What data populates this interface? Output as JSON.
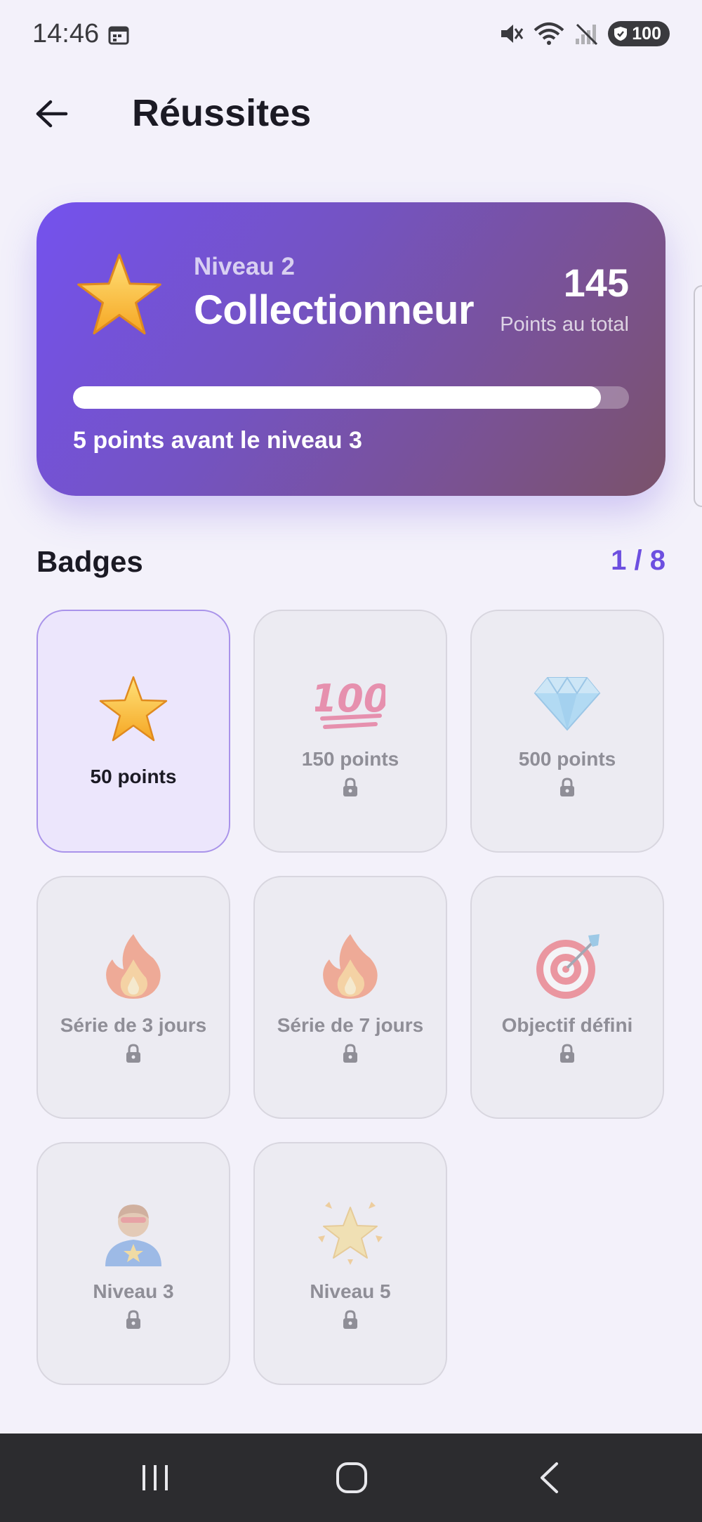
{
  "status": {
    "time": "14:46",
    "battery": "100"
  },
  "header": {
    "title": "Réussites"
  },
  "level_card": {
    "level_label": "Niveau 2",
    "level_name": "Collectionneur",
    "points_value": "145",
    "points_caption": "Points au total",
    "progress_fraction": 0.95,
    "progress_text": "5 points avant le niveau 3"
  },
  "badges": {
    "title": "Badges",
    "count": "1 / 8",
    "items": [
      {
        "label": "50 points",
        "icon": "star-icon",
        "unlocked": true
      },
      {
        "label": "150 points",
        "icon": "hundred-points-icon",
        "unlocked": false
      },
      {
        "label": "500 points",
        "icon": "gem-icon",
        "unlocked": false
      },
      {
        "label": "Série de 3 jours",
        "icon": "fire-icon",
        "unlocked": false
      },
      {
        "label": "Série de 7 jours",
        "icon": "fire-icon",
        "unlocked": false
      },
      {
        "label": "Objectif défini",
        "icon": "target-icon",
        "unlocked": false
      },
      {
        "label": "Niveau 3",
        "icon": "superhero-icon",
        "unlocked": false
      },
      {
        "label": "Niveau 5",
        "icon": "sparkle-star-icon",
        "unlocked": false
      }
    ]
  },
  "colors": {
    "accent": "#6d4fe0",
    "card_gradient_start": "#7452ee",
    "card_gradient_end": "#7a526a",
    "background": "#f3f1fa"
  }
}
